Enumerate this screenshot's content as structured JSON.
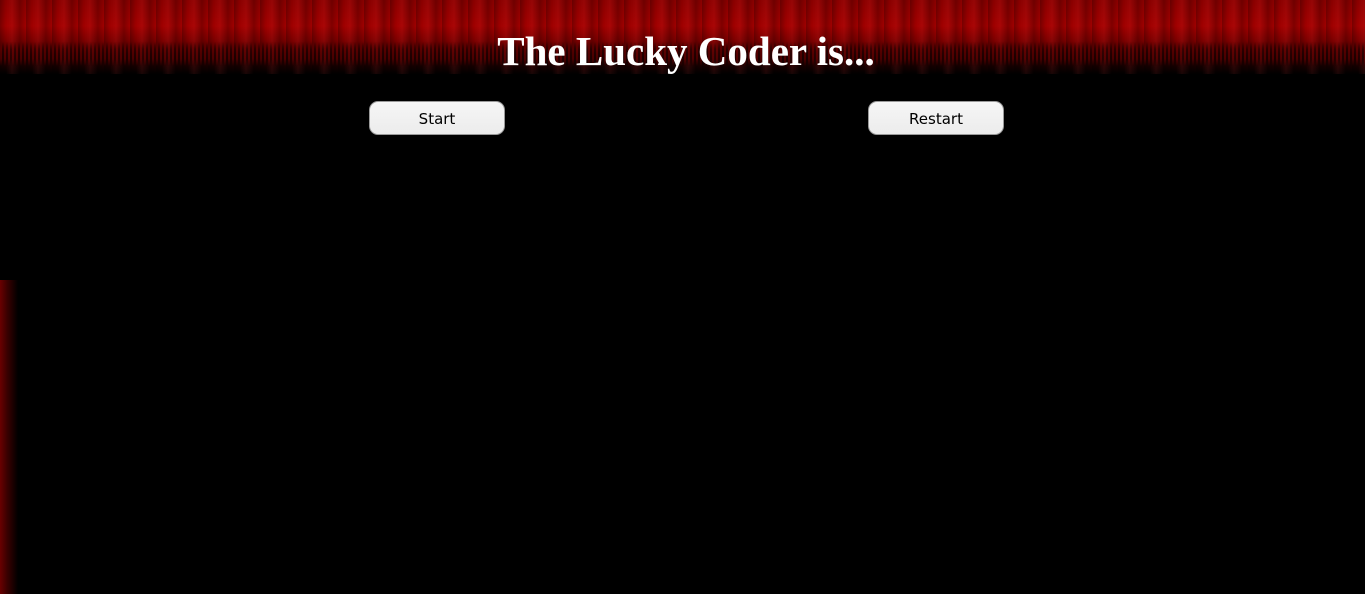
{
  "page": {
    "title": "The Lucky Coder is..."
  },
  "controls": {
    "start_label": "Start",
    "restart_label": "Restart"
  },
  "colors": {
    "background": "#000000",
    "curtain": "#9a0000",
    "title_text": "#ffffff",
    "button_bg": "#f0f0f0"
  }
}
